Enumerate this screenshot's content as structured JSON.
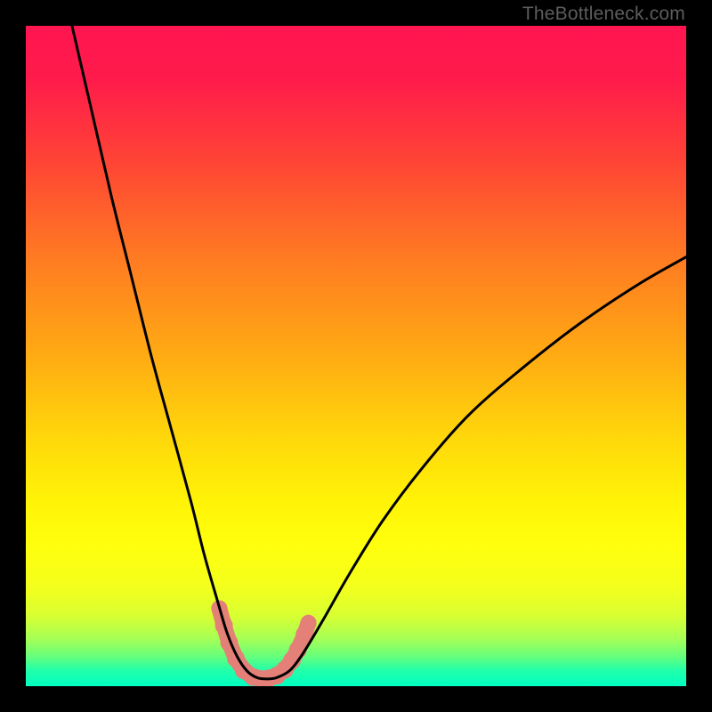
{
  "watermark": "TheBottleneck.com",
  "gradient": {
    "stops": [
      {
        "offset": 0.0,
        "color": "#ff1550"
      },
      {
        "offset": 0.08,
        "color": "#ff1b4b"
      },
      {
        "offset": 0.2,
        "color": "#ff4236"
      },
      {
        "offset": 0.35,
        "color": "#ff7a22"
      },
      {
        "offset": 0.5,
        "color": "#ffab13"
      },
      {
        "offset": 0.62,
        "color": "#ffd60b"
      },
      {
        "offset": 0.72,
        "color": "#fff307"
      },
      {
        "offset": 0.79,
        "color": "#ffff0e"
      },
      {
        "offset": 0.85,
        "color": "#f3ff1c"
      },
      {
        "offset": 0.895,
        "color": "#d7ff33"
      },
      {
        "offset": 0.928,
        "color": "#a6ff55"
      },
      {
        "offset": 0.955,
        "color": "#66ff7c"
      },
      {
        "offset": 0.975,
        "color": "#24ffa8"
      },
      {
        "offset": 1.0,
        "color": "#00ffc1"
      }
    ]
  },
  "chart_data": {
    "type": "line",
    "title": "",
    "xlabel": "",
    "ylabel": "",
    "xlim": [
      0,
      100
    ],
    "ylim": [
      0,
      100
    ],
    "series": [
      {
        "name": "bottleneck-curve",
        "x": [
          7,
          10,
          13,
          16,
          19,
          22,
          25,
          27,
          29,
          30.5,
          32,
          33.5,
          35,
          36.5,
          38,
          40,
          42,
          45,
          49,
          54,
          60,
          67,
          75,
          84,
          93,
          100
        ],
        "y": [
          100,
          87,
          74,
          62,
          50,
          39,
          28,
          20,
          13,
          8,
          4.5,
          2.3,
          1.3,
          1.1,
          1.3,
          2.4,
          5,
          10,
          17,
          25,
          33,
          41,
          48,
          55,
          61,
          65
        ]
      }
    ],
    "highlight_band": {
      "name": "optimal-range",
      "color": "#e37f77",
      "points_xy": [
        [
          29.3,
          11.8
        ],
        [
          30.0,
          9.2
        ],
        [
          30.8,
          6.6
        ],
        [
          31.8,
          4.2
        ],
        [
          33.0,
          2.4
        ],
        [
          34.4,
          1.4
        ],
        [
          35.6,
          1.1
        ],
        [
          36.8,
          1.2
        ],
        [
          38.0,
          1.6
        ],
        [
          39.2,
          2.5
        ],
        [
          40.3,
          3.9
        ],
        [
          41.2,
          5.5
        ],
        [
          42.2,
          7.8
        ],
        [
          42.8,
          9.6
        ]
      ]
    }
  }
}
